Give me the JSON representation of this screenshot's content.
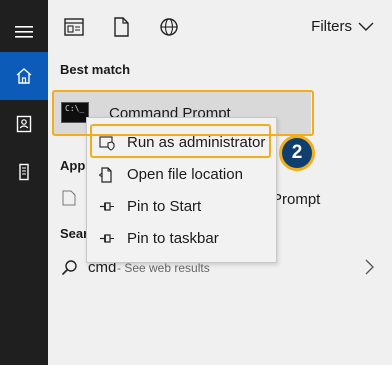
{
  "rail": {
    "icons": [
      "hamburger-icon",
      "home-icon",
      "document-icon",
      "tower-icon"
    ]
  },
  "toolbar": {
    "icons": [
      "apps-icon",
      "documents-icon",
      "web-icon"
    ],
    "filters_label": "Filters"
  },
  "best_match": {
    "heading": "Best match",
    "item_label": "Command Prompt",
    "icon_text": "C:\\_"
  },
  "apps": {
    "heading": "Apps",
    "item_label_visible": "Prompt"
  },
  "search_web": {
    "heading": "Search the web",
    "query": "cmd",
    "suffix": " - See web results"
  },
  "context_menu": {
    "items": [
      {
        "label": "Run as administrator",
        "icon": "shield-icon"
      },
      {
        "label": "Open file location",
        "icon": "folder-icon"
      },
      {
        "label": "Pin to Start",
        "icon": "pin-icon"
      },
      {
        "label": "Pin to taskbar",
        "icon": "pin-icon"
      }
    ]
  },
  "step_badge": "2",
  "colors": {
    "accent": "#0c5bb8",
    "highlight": "#f2ad1b",
    "badge": "#0e3f6f",
    "rail": "#1f1f1f"
  }
}
